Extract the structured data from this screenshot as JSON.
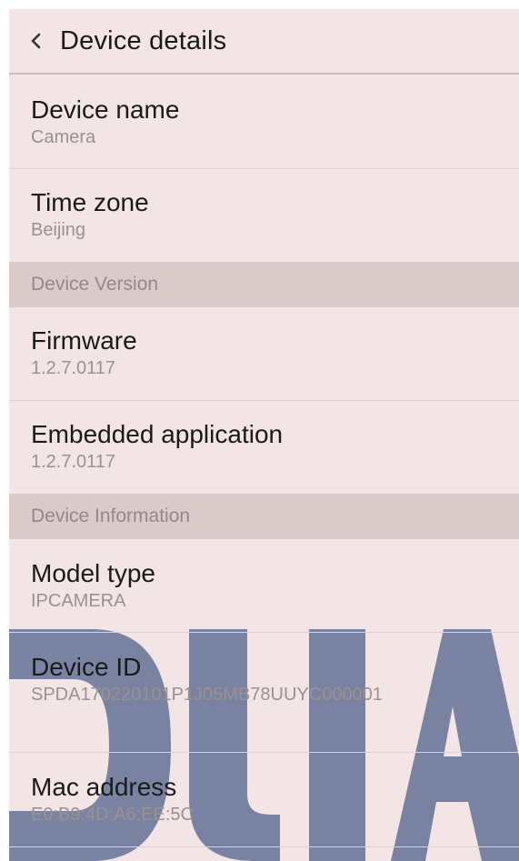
{
  "header": {
    "title": "Device details"
  },
  "rows": {
    "device_name": {
      "label": "Device name",
      "value": "Camera"
    },
    "time_zone": {
      "label": "Time zone",
      "value": "Beijing"
    },
    "firmware": {
      "label": "Firmware",
      "value": "1.2.7.0117"
    },
    "embedded_app": {
      "label": "Embedded application",
      "value": "1.2.7.0117"
    },
    "model_type": {
      "label": "Model type",
      "value": "IPCAMERA"
    },
    "device_id": {
      "label": "Device ID",
      "value": "SPDA170220101P1J05MB78UUYC000001"
    },
    "mac_address": {
      "label": "Mac address",
      "value": "E0:B9:4D:A6:EE:5C"
    }
  },
  "sections": {
    "device_version": "Device Version",
    "device_information": "Device Information"
  },
  "colors": {
    "background": "#f3e5e5",
    "section_background": "#dbcaca",
    "watermark": "#5f6e93"
  }
}
